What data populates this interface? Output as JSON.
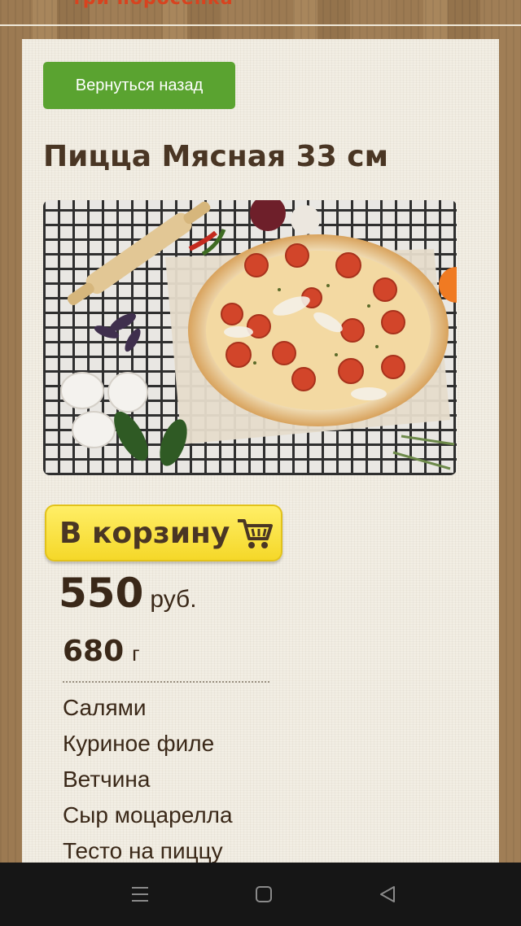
{
  "header": {
    "logo_text": "три поросёнка"
  },
  "product": {
    "back_label": "Вернуться назад",
    "title": "Пицца Мясная 33 см",
    "cart_label": "В корзину",
    "price": "550",
    "currency": "руб.",
    "weight": "680",
    "weight_unit": "г",
    "ingredients": [
      "Салями",
      "Куриное филе",
      "Ветчина",
      "Сыр моцарелла",
      "Тесто на пиццу"
    ]
  },
  "icons": {
    "cart": "shopping-cart-icon",
    "menu": "menu-icon",
    "home": "home-square-icon",
    "back": "back-triangle-icon"
  },
  "colors": {
    "back_button": "#5aa330",
    "cart_button": "#f5d829",
    "title_text": "#4a3624",
    "card_background": "#f2eee4",
    "navbar": "#161616"
  }
}
